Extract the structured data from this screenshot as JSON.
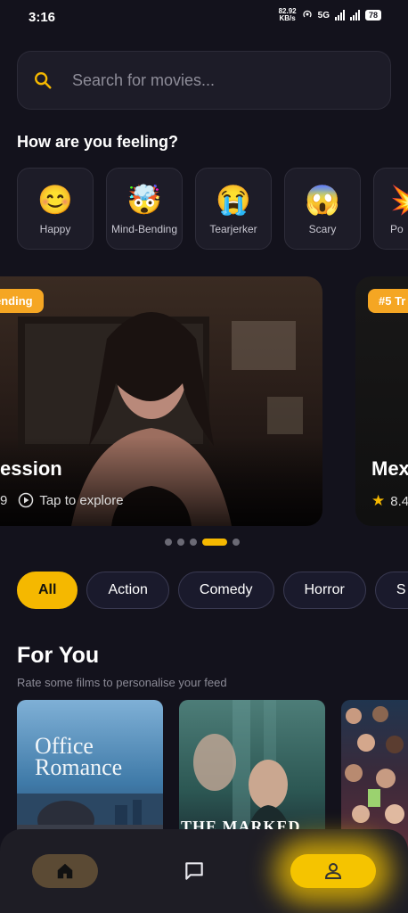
{
  "status": {
    "time": "3:16",
    "speed_value": "82.92",
    "speed_unit": "KB/s",
    "network": "5G",
    "battery": "78"
  },
  "search": {
    "placeholder": "Search for movies..."
  },
  "mood_section": {
    "title": "How are you feeling?"
  },
  "moods": [
    {
      "emoji": "😊",
      "label": "Happy"
    },
    {
      "emoji": "🤯",
      "label": "Mind-Bending"
    },
    {
      "emoji": "😭",
      "label": "Tearjerker"
    },
    {
      "emoji": "😱",
      "label": "Scary"
    },
    {
      "emoji": "💥",
      "label": "Po"
    }
  ],
  "carousel": {
    "cards": [
      {
        "tag": "ending",
        "title": "ession",
        "meta_prefix": "9",
        "action": "Tap to explore"
      },
      {
        "tag": "#5 Tr",
        "title": "Mex",
        "rating": "8.4"
      }
    ],
    "active_index": 3,
    "count": 5
  },
  "genres": [
    "All",
    "Action",
    "Comedy",
    "Horror",
    "S"
  ],
  "for_you": {
    "title": "For You",
    "subtitle": "Rate some films to personalise your feed"
  },
  "posters": [
    {
      "title_line1": "Office",
      "title_line2": "Romance"
    },
    {
      "title": "THE MARKED WOMAN"
    },
    {
      "title": ""
    }
  ],
  "nav": {
    "items": [
      "home",
      "messages",
      "profile"
    ],
    "active": "profile"
  },
  "colors": {
    "accent": "#F5B800",
    "background": "#13121C",
    "surface": "#1D1C28"
  }
}
